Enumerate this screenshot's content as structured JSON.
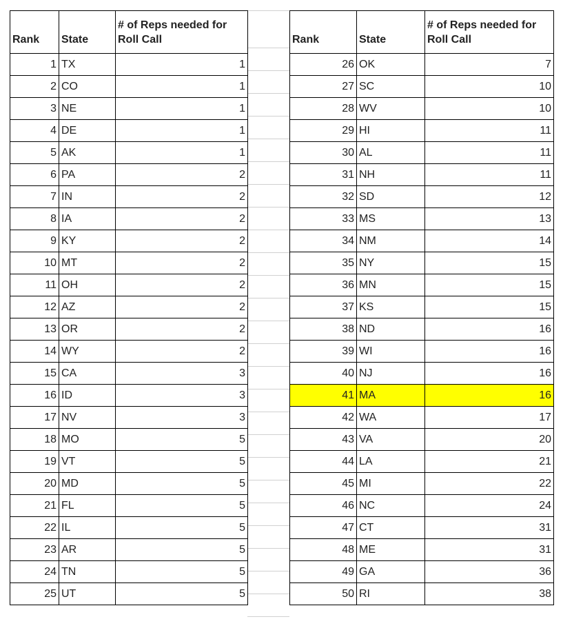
{
  "headers": {
    "rank": "Rank",
    "state": "State",
    "reps": "# of Reps needed for Roll Call"
  },
  "highlight_color": "#ffff00",
  "left_table": [
    {
      "rank": "1",
      "state": "TX",
      "reps": "1"
    },
    {
      "rank": "2",
      "state": "CO",
      "reps": "1"
    },
    {
      "rank": "3",
      "state": "NE",
      "reps": "1"
    },
    {
      "rank": "4",
      "state": "DE",
      "reps": "1"
    },
    {
      "rank": "5",
      "state": "AK",
      "reps": "1"
    },
    {
      "rank": "6",
      "state": "PA",
      "reps": "2"
    },
    {
      "rank": "7",
      "state": "IN",
      "reps": "2"
    },
    {
      "rank": "8",
      "state": "IA",
      "reps": "2"
    },
    {
      "rank": "9",
      "state": "KY",
      "reps": "2"
    },
    {
      "rank": "10",
      "state": "MT",
      "reps": "2"
    },
    {
      "rank": "11",
      "state": "OH",
      "reps": "2"
    },
    {
      "rank": "12",
      "state": "AZ",
      "reps": "2"
    },
    {
      "rank": "13",
      "state": "OR",
      "reps": "2"
    },
    {
      "rank": "14",
      "state": "WY",
      "reps": "2"
    },
    {
      "rank": "15",
      "state": "CA",
      "reps": "3"
    },
    {
      "rank": "16",
      "state": "ID",
      "reps": "3"
    },
    {
      "rank": "17",
      "state": "NV",
      "reps": "3"
    },
    {
      "rank": "18",
      "state": "MO",
      "reps": "5"
    },
    {
      "rank": "19",
      "state": "VT",
      "reps": "5"
    },
    {
      "rank": "20",
      "state": "MD",
      "reps": "5"
    },
    {
      "rank": "21",
      "state": "FL",
      "reps": "5"
    },
    {
      "rank": "22",
      "state": "IL",
      "reps": "5"
    },
    {
      "rank": "23",
      "state": "AR",
      "reps": "5"
    },
    {
      "rank": "24",
      "state": "TN",
      "reps": "5"
    },
    {
      "rank": "25",
      "state": "UT",
      "reps": "5"
    }
  ],
  "right_table": [
    {
      "rank": "26",
      "state": "OK",
      "reps": "7"
    },
    {
      "rank": "27",
      "state": "SC",
      "reps": "10"
    },
    {
      "rank": "28",
      "state": "WV",
      "reps": "10"
    },
    {
      "rank": "29",
      "state": "HI",
      "reps": "11"
    },
    {
      "rank": "30",
      "state": "AL",
      "reps": "11"
    },
    {
      "rank": "31",
      "state": "NH",
      "reps": "11"
    },
    {
      "rank": "32",
      "state": "SD",
      "reps": "12"
    },
    {
      "rank": "33",
      "state": "MS",
      "reps": "13"
    },
    {
      "rank": "34",
      "state": "NM",
      "reps": "14"
    },
    {
      "rank": "35",
      "state": "NY",
      "reps": "15"
    },
    {
      "rank": "36",
      "state": "MN",
      "reps": "15"
    },
    {
      "rank": "37",
      "state": "KS",
      "reps": "15"
    },
    {
      "rank": "38",
      "state": "ND",
      "reps": "16"
    },
    {
      "rank": "39",
      "state": "WI",
      "reps": "16"
    },
    {
      "rank": "40",
      "state": "NJ",
      "reps": "16"
    },
    {
      "rank": "41",
      "state": "MA",
      "reps": "16",
      "highlighted": true
    },
    {
      "rank": "42",
      "state": "WA",
      "reps": "17"
    },
    {
      "rank": "43",
      "state": "VA",
      "reps": "20"
    },
    {
      "rank": "44",
      "state": "LA",
      "reps": "21"
    },
    {
      "rank": "45",
      "state": "MI",
      "reps": "22"
    },
    {
      "rank": "46",
      "state": "NC",
      "reps": "24"
    },
    {
      "rank": "47",
      "state": "CT",
      "reps": "31"
    },
    {
      "rank": "48",
      "state": "ME",
      "reps": "31"
    },
    {
      "rank": "49",
      "state": "GA",
      "reps": "36"
    },
    {
      "rank": "50",
      "state": "RI",
      "reps": "38"
    }
  ]
}
